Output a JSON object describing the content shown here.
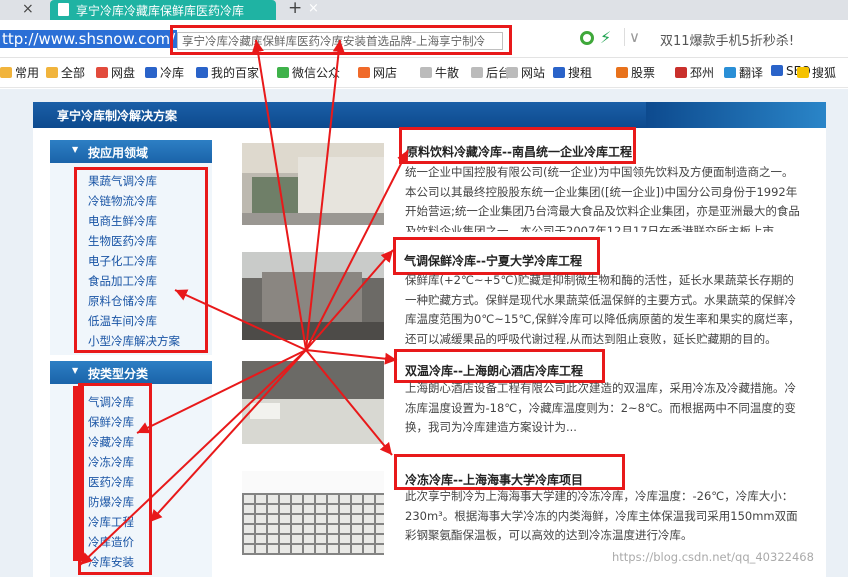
{
  "browser": {
    "prev_tab_close": "×",
    "tab_title": "享宁冷库冷藏库保鲜库医药冷库",
    "tab_close": "×",
    "new_tab": "+",
    "url": "ttp://www.shsnow.com/",
    "address_hint": "享宁冷库冷藏库保鲜库医药冷库安装首选品牌-上海享宁制冷",
    "chevron": "∨",
    "lightning": "⚡",
    "promo": "双11爆款手机5折秒杀!"
  },
  "bookmarks": [
    {
      "label": "常用",
      "color": "#f1b43c"
    },
    {
      "label": "全部",
      "color": "#f1b43c"
    },
    {
      "label": "网盘",
      "color": "#e24b3c"
    },
    {
      "label": "冷库",
      "color": "#2a63c9"
    },
    {
      "label": "我的百家",
      "color": "#2a63c9"
    },
    {
      "label": "微信公众",
      "color": "#3fb24a"
    },
    {
      "label": "网店",
      "color": "#f06a2a"
    },
    {
      "label": "牛散",
      "color": "#bbbbbb"
    },
    {
      "label": "后台",
      "color": "#bbbbbb"
    },
    {
      "label": "网站",
      "color": "#bbbbbb"
    },
    {
      "label": "搜租",
      "color": "#2a63c9"
    },
    {
      "label": "股票",
      "color": "#e8721c"
    },
    {
      "label": "邳州",
      "color": "#c9302c"
    },
    {
      "label": "翻译",
      "color": "#2a8fd6"
    },
    {
      "label": "SEO",
      "color": "#2a63c9"
    },
    {
      "label": "搜狐",
      "color": "#f5c200"
    }
  ],
  "page": {
    "section_title": "享宁冷库制冷解决方案",
    "by_application": {
      "header": "按应用领域",
      "items": [
        "果蔬气调冷库",
        "冷链物流冷库",
        "电商生鲜冷库",
        "生物医药冷库",
        "电子化工冷库",
        "食品加工冷库",
        "原料仓储冷库",
        "低温车间冷库",
        "小型冷库解决方案"
      ]
    },
    "by_type": {
      "header": "按类型分类",
      "items": [
        "气调冷库",
        "保鲜冷库",
        "冷藏冷库",
        "冷冻冷库",
        "医药冷库",
        "防爆冷库",
        "冷库工程",
        "冷库造价",
        "冷库安装"
      ]
    },
    "articles": [
      {
        "title": "原料饮料冷藏冷库--南昌统一企业冷库工程",
        "body": "统一企业中国控股有限公司(统一企业)为中国领先饮料及方便面制造商之一。本公司以其最终控股股东统一企业集团([统一企业])中国分公司身份于1992年开始营运;统一企业集团乃台湾最大食品及饮料企业集团，亦是亚洲最大的食品及饮料企业集团之一。本公司于2007年12月17日在香港联交所主板上市"
      },
      {
        "title": "气调保鲜冷库--宁夏大学冷库工程",
        "body": "保鲜库(+2℃~+5℃)贮藏是抑制微生物和酶的活性，延长水果蔬菜长存期的一种贮藏方式。保鲜是现代水果蔬菜低温保鲜的主要方式。水果蔬菜的保鲜冷库温度范围为0℃~15℃,保鲜冷库可以降低病原菌的发生率和果实的腐烂率，还可以减缓果品的呼吸代谢过程,从而达到阻止衰败，延长贮藏期的目的。"
      },
      {
        "title": "双温冷库--上海朗心酒店冷库工程",
        "body": "上海朗心酒店设备工程有限公司此次建造的双温库，采用冷冻及冷藏措施。冷冻库温度设置为-18℃，冷藏库温度则为：2~8℃。而根据两中不同温度的变换，我司为冷库建造方案设计为..."
      },
      {
        "title": "冷冻冷库--上海海事大学冷库项目",
        "body": "此次享宁制冷为上海海事大学建的冷冻冷库，冷库温度：-26℃，冷库大小：230m³。根据海事大学冷冻的内类海鲜，冷库主体保温我司采用150mm双面彩钢聚氨酯保温板，可以高效的达到冷冻温度进行冷库。"
      }
    ],
    "watermark": "https://blog.csdn.net/qq_40322468"
  },
  "colors": {
    "annotation_red": "#e8191a",
    "accent_teal": "#1fb3a3",
    "nav_blue": "#1a63a9",
    "link_blue": "#1a55a5"
  }
}
